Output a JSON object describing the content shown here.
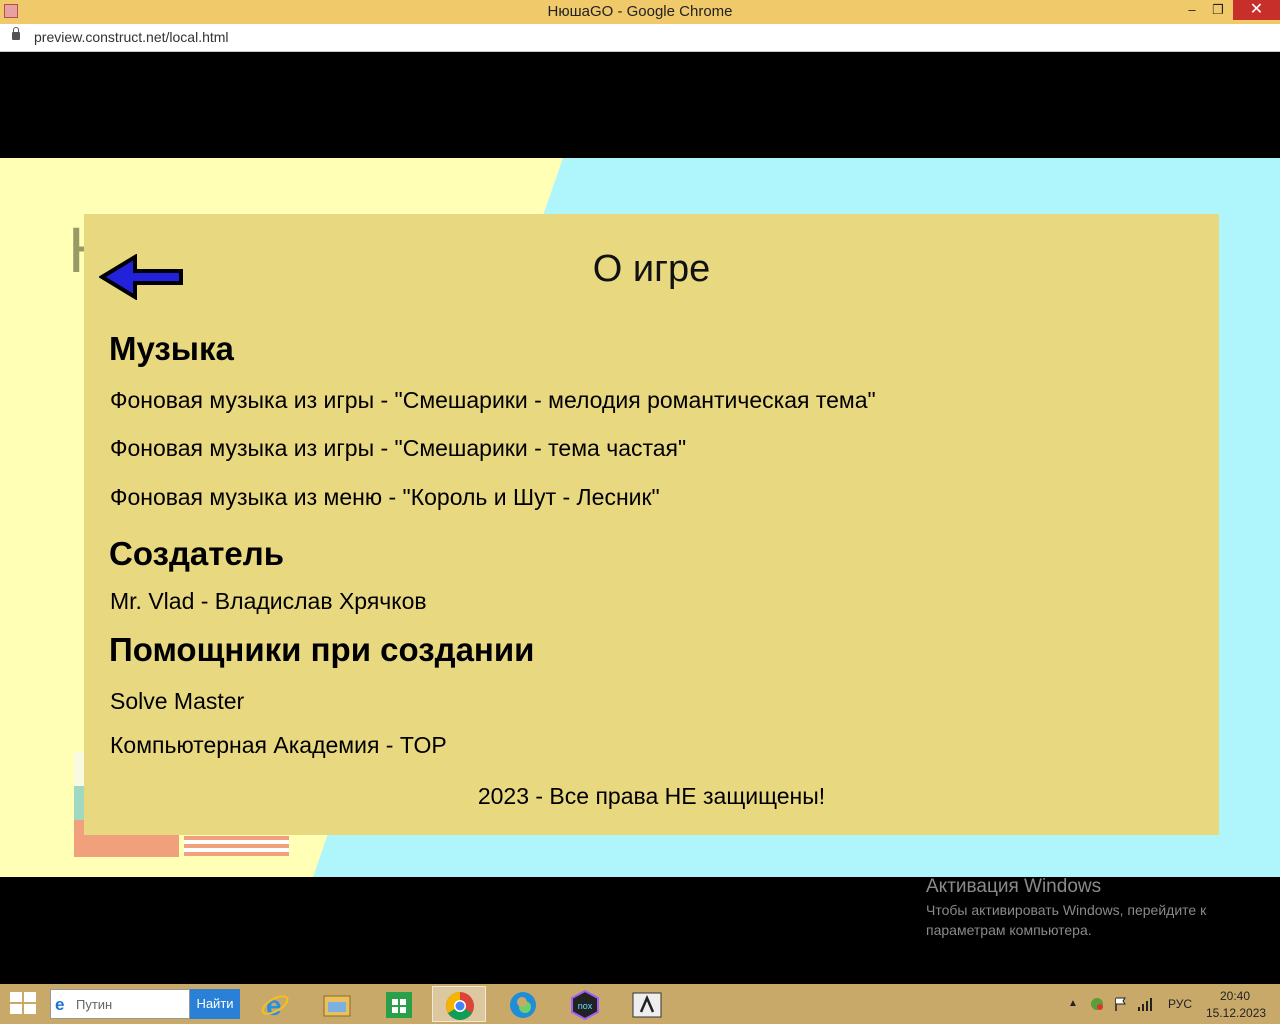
{
  "window": {
    "title": "НюшаGO - Google Chrome",
    "min_label": "‒",
    "max_label": "❐",
    "close_label": "✕"
  },
  "address": {
    "url": "preview.construct.net/local.html"
  },
  "game": {
    "bg_letter": "Н",
    "panel": {
      "title": "О игре",
      "music_heading": "Музыка",
      "music_items": [
        "Фоновая музыка из игры - \"Смешарики - мелодия романтическая тема\"",
        "Фоновая музыка из игры - \"Смешарики - тема частая\"",
        "Фоновая музыка из меню - \"Король и Шут - Лесник\""
      ],
      "creator_heading": "Создатель",
      "creator": "Mr. Vlad - Владислав Хрячков",
      "helpers_heading": "Помощники при создании",
      "helpers": [
        "Solve Master",
        "Компьютерная Академия - TOP"
      ],
      "copyright": "2023 - Все права НЕ защищены!"
    }
  },
  "watermark": {
    "title": "Активация Windows",
    "text": "Чтобы активировать Windows, перейдите к параметрам компьютера."
  },
  "taskbar": {
    "search_placeholder": "Путин",
    "search_button": "Найти",
    "language": "РУС",
    "time": "20:40",
    "date": "15.12.2023"
  },
  "colors": {
    "panel": "#e8d880",
    "arrow": "#2222dd",
    "cyan_bg": "#aef6fb",
    "yellow_bg": "#ffffb6",
    "taskbar": "#c9a96a"
  }
}
